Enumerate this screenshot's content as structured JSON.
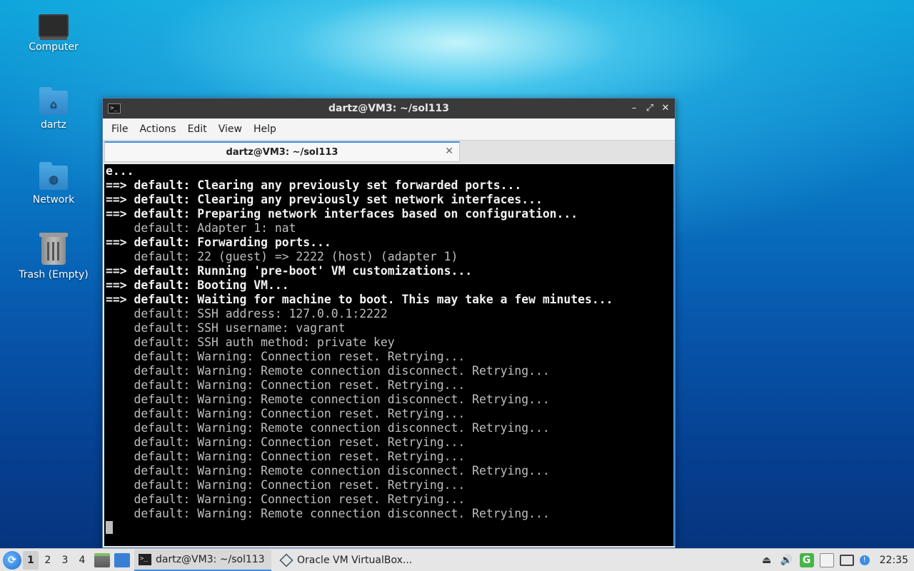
{
  "desktop": {
    "icons": [
      {
        "label": "Computer"
      },
      {
        "label": "dartz"
      },
      {
        "label": "Network"
      },
      {
        "label": "Trash (Empty)"
      }
    ]
  },
  "window": {
    "title": "dartz@VM3: ~/sol113",
    "menu": [
      "File",
      "Actions",
      "Edit",
      "View",
      "Help"
    ],
    "tab_label": "dartz@VM3: ~/sol113",
    "terminal_lines": [
      {
        "text": "e...",
        "bold": true
      },
      {
        "text": "==> default: Clearing any previously set forwarded ports...",
        "bold": true
      },
      {
        "text": "==> default: Clearing any previously set network interfaces...",
        "bold": true
      },
      {
        "text": "==> default: Preparing network interfaces based on configuration...",
        "bold": true
      },
      {
        "text": "    default: Adapter 1: nat",
        "bold": false
      },
      {
        "text": "==> default: Forwarding ports...",
        "bold": true
      },
      {
        "text": "    default: 22 (guest) => 2222 (host) (adapter 1)",
        "bold": false
      },
      {
        "text": "==> default: Running 'pre-boot' VM customizations...",
        "bold": true
      },
      {
        "text": "==> default: Booting VM...",
        "bold": true
      },
      {
        "text": "==> default: Waiting for machine to boot. This may take a few minutes...",
        "bold": true
      },
      {
        "text": "    default: SSH address: 127.0.0.1:2222",
        "bold": false
      },
      {
        "text": "    default: SSH username: vagrant",
        "bold": false
      },
      {
        "text": "    default: SSH auth method: private key",
        "bold": false
      },
      {
        "text": "    default: Warning: Connection reset. Retrying...",
        "bold": false
      },
      {
        "text": "    default: Warning: Remote connection disconnect. Retrying...",
        "bold": false
      },
      {
        "text": "    default: Warning: Connection reset. Retrying...",
        "bold": false
      },
      {
        "text": "    default: Warning: Remote connection disconnect. Retrying...",
        "bold": false
      },
      {
        "text": "    default: Warning: Connection reset. Retrying...",
        "bold": false
      },
      {
        "text": "    default: Warning: Remote connection disconnect. Retrying...",
        "bold": false
      },
      {
        "text": "    default: Warning: Connection reset. Retrying...",
        "bold": false
      },
      {
        "text": "    default: Warning: Connection reset. Retrying...",
        "bold": false
      },
      {
        "text": "    default: Warning: Remote connection disconnect. Retrying...",
        "bold": false
      },
      {
        "text": "    default: Warning: Connection reset. Retrying...",
        "bold": false
      },
      {
        "text": "    default: Warning: Connection reset. Retrying...",
        "bold": false
      },
      {
        "text": "    default: Warning: Remote connection disconnect. Retrying...",
        "bold": false
      }
    ]
  },
  "taskbar": {
    "workspaces": [
      "1",
      "2",
      "3",
      "4"
    ],
    "active_workspace": "1",
    "tasks": [
      {
        "label": "dartz@VM3: ~/sol113",
        "icon": "terminal-icon"
      },
      {
        "label": "Oracle VM VirtualBox...",
        "icon": "virtualbox-icon"
      }
    ],
    "clock": "22:35"
  },
  "colors": {
    "accent": "#3d8ee0",
    "terminal_bg": "#000000",
    "terminal_fg": "#bfbfbf",
    "titlebar_bg": "#3a3a3a"
  }
}
